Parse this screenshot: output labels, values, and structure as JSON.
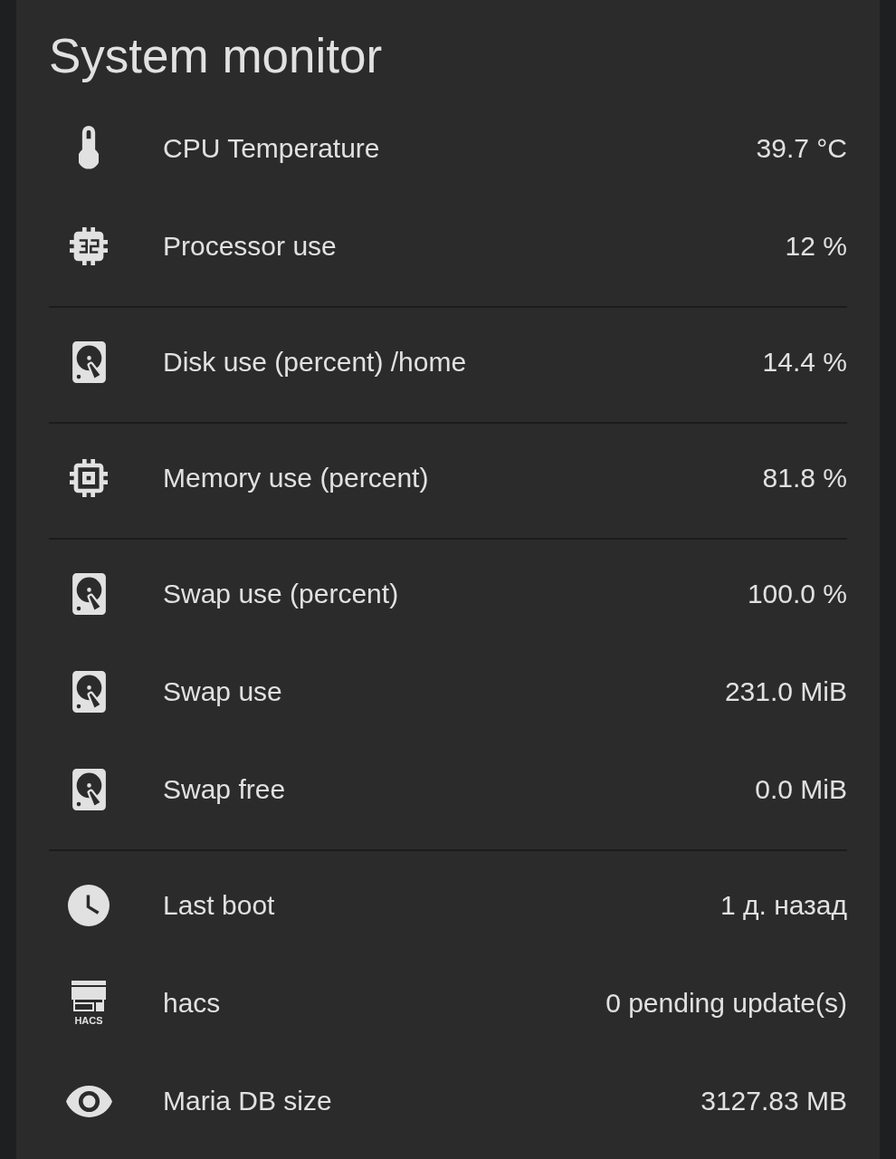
{
  "card": {
    "title": "System monitor",
    "groups": [
      {
        "rows": [
          {
            "kind": "temperature",
            "name": "CPU Temperature",
            "value": "39.7 °C"
          },
          {
            "kind": "processor",
            "name": "Processor use",
            "value": "12 %"
          }
        ]
      },
      {
        "rows": [
          {
            "kind": "disk",
            "name": "Disk use (percent) /home",
            "value": "14.4 %"
          }
        ]
      },
      {
        "rows": [
          {
            "kind": "memory",
            "name": "Memory use (percent)",
            "value": "81.8 %"
          }
        ]
      },
      {
        "rows": [
          {
            "kind": "disk",
            "name": "Swap use (percent)",
            "value": "100.0 %"
          },
          {
            "kind": "disk",
            "name": "Swap use",
            "value": "231.0 MiB"
          },
          {
            "kind": "disk",
            "name": "Swap free",
            "value": "0.0 MiB"
          }
        ]
      },
      {
        "rows": [
          {
            "kind": "uptime",
            "name": "Last boot",
            "value": "1 д. назад"
          },
          {
            "kind": "updates",
            "name": "hacs",
            "value": "0 pending update(s)",
            "icon_label": "HACS"
          },
          {
            "kind": "database",
            "name": "Maria DB size",
            "value": "3127.83 MB"
          }
        ]
      }
    ]
  }
}
